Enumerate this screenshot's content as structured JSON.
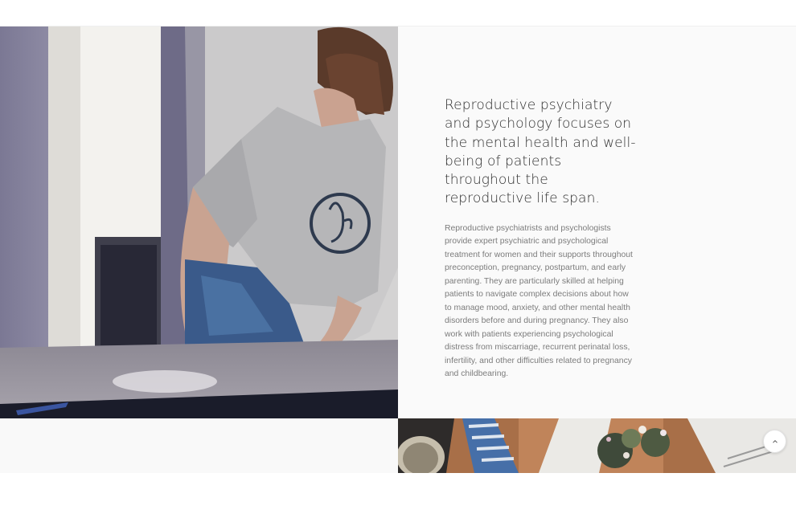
{
  "content": {
    "headline": "Reproductive psychiatry and psychology focuses on the mental health and well-being of patients throughout the reproductive life span.",
    "body": "Reproductive psychiatrists and psychologists provide expert psychiatric and psychological treatment for women and their supports throughout preconception, pregnancy, postpartum, and early parenting. They are particularly skilled at helping patients to navigate complex decisions about how to manage mood, anxiety, and other mental health disorders before and during pregnancy. They also work with patients experiencing psychological distress from miscarriage, recurrent perinatal loss, infertility, and other difficulties related to pregnancy and childbearing."
  },
  "images": {
    "artist_photo": "woman-drawing-at-table-photo",
    "still_life_photo": "flowers-and-book-still-life-photo"
  },
  "controls": {
    "scroll_top_icon": "chevron-up-icon"
  },
  "colors": {
    "panel_background": "#fafafa",
    "headline": "#2d2d2d",
    "body_text": "#7c7c7c"
  }
}
